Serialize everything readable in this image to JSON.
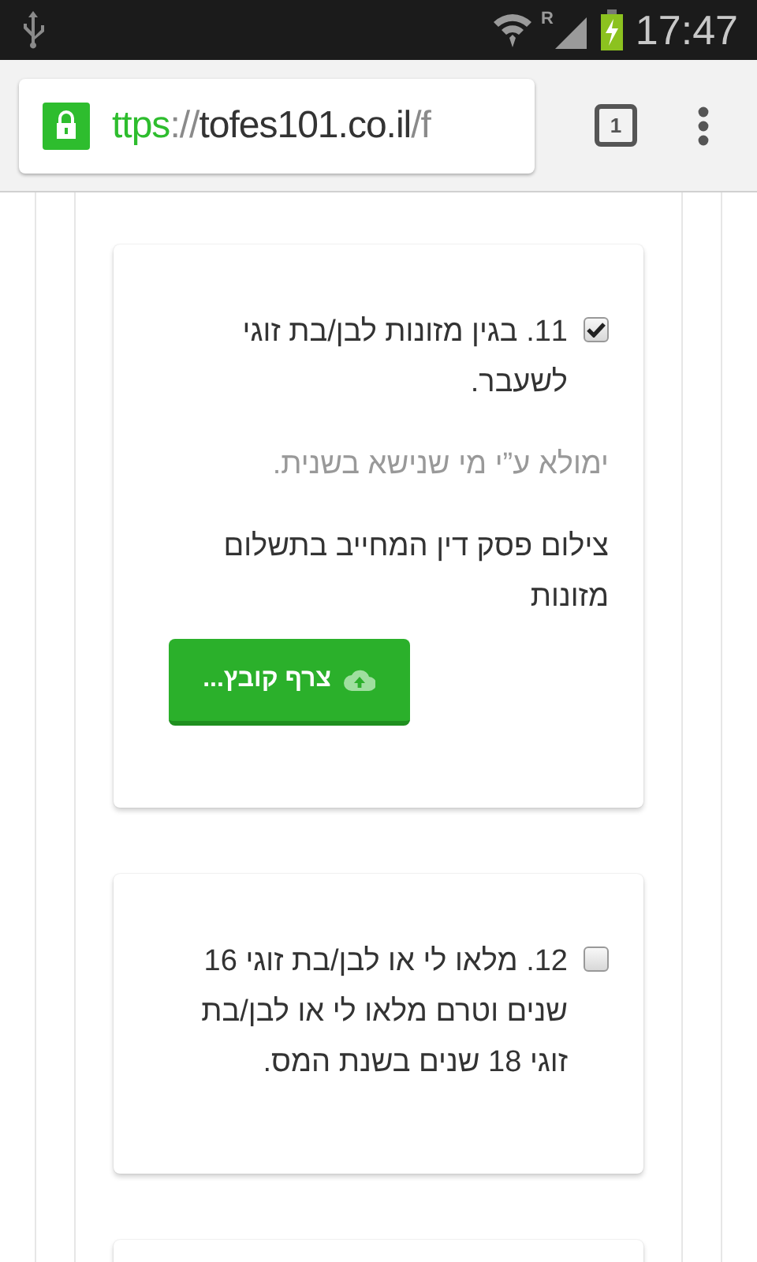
{
  "status_bar": {
    "roaming": "R",
    "time": "17:47"
  },
  "browser": {
    "secure": true,
    "url": {
      "scheme": "ttps",
      "separator": "://",
      "host": "tofes101.co.il",
      "path": "/f"
    },
    "tab_count": "1"
  },
  "cards": [
    {
      "kind": "question",
      "items": [
        {
          "kind": "checkbox",
          "text": "11. בגין מזונות לבן/בת זוגי לשעבר.",
          "checked": true
        },
        {
          "kind": "note",
          "text": "ימולא ע”י מי שנישא בשנית."
        },
        {
          "kind": "text",
          "text": "צילום פסק דין המחייב בתשלום מזונות"
        },
        {
          "kind": "upload",
          "text": "צרף קובץ..."
        }
      ]
    },
    {
      "kind": "question",
      "items": [
        {
          "kind": "checkbox",
          "text": "12. מלאו לי או לבן/בת זוגי 16 שנים וטרם מלאו לי או לבן/בת זוגי 18 שנים בשנת המס.",
          "checked": false
        }
      ]
    },
    {
      "kind": "question"
    }
  ]
}
